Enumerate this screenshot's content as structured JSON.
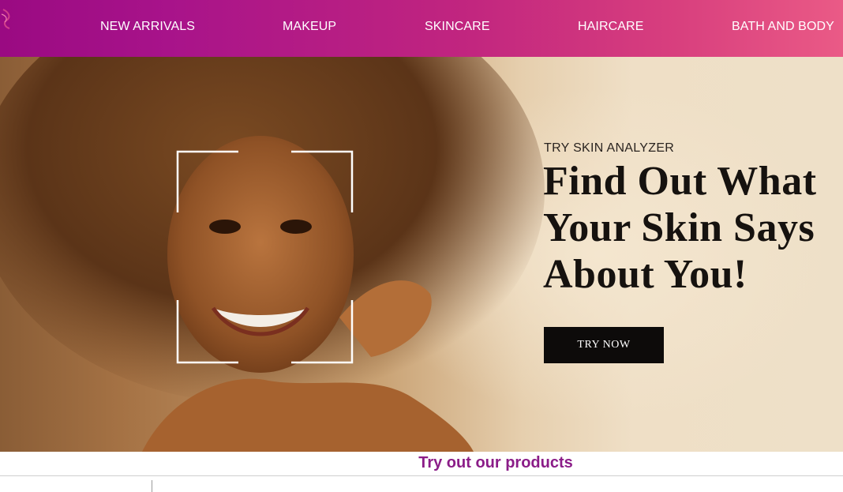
{
  "nav": {
    "brand_icon": "swirl-logo-icon",
    "items": [
      {
        "label": "NEW ARRIVALS"
      },
      {
        "label": "MAKEUP"
      },
      {
        "label": "SKINCARE"
      },
      {
        "label": "HAIRCARE"
      },
      {
        "label": "BATH AND BODY"
      }
    ]
  },
  "hero": {
    "subtitle": "TRY SKIN ANALYZER",
    "title_lines": [
      "Find Out What",
      "Your Skin Says",
      "About You!"
    ],
    "cta_label": "TRY NOW",
    "image": "smiling-woman-with-curly-hair-face-scan-frame"
  },
  "section": {
    "title": "Try out our products"
  },
  "colors": {
    "nav_gradient_start": "#9a0a82",
    "nav_gradient_end": "#ea5a86",
    "section_title": "#8b1d88",
    "cta_background": "#0d0b0a"
  }
}
